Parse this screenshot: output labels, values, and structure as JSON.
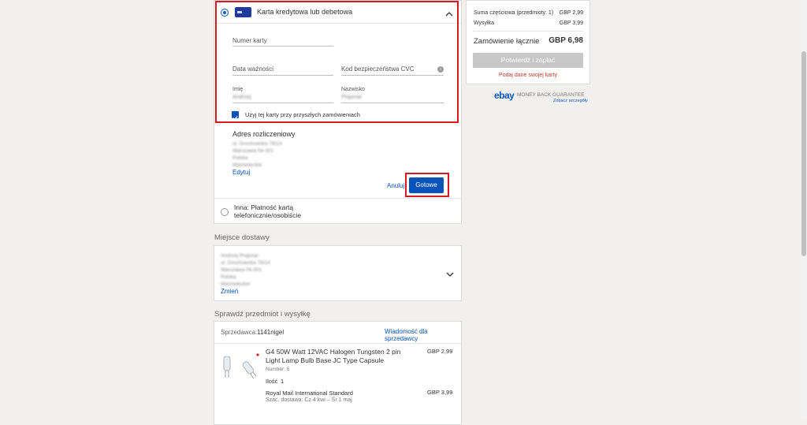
{
  "payment": {
    "card_title": "Karta kredytowa lub debetowa",
    "card_number_label": "Numer karty",
    "expiry_label": "Data ważności",
    "cvc_label": "Kod bezpieczeństwa CVC",
    "first_name_label": "Imię",
    "first_name_value": "Andrzej",
    "last_name_label": "Nazwisko",
    "last_name_value": "Prajsnar",
    "save_card_label": "Użyj tej karty przy przyszłych zamówieniach",
    "save_card_checked": true,
    "billing_title": "Adres rozliczeniowy",
    "billing_lines": [
      "ul. Grochowska 78/14",
      "Warszawa 04-301",
      "Polska",
      "Mazowieckie"
    ],
    "edit_label": "Edytuj",
    "cancel_label": "Anuluj",
    "done_label": "Gotowe",
    "other_option_label": "Inna: Płatność kartą telefonicznie/osobiście"
  },
  "delivery": {
    "section_title": "Miejsce dostawy",
    "lines": [
      "Andrzej Prajsnar",
      "ul. Grochowska 78/14",
      "Warszawa 04-301",
      "Polska",
      "Mazowieckie"
    ],
    "change_label": "Zmień"
  },
  "review": {
    "section_title": "Sprawdź przedmiot i wysyłkę",
    "seller_prefix": "Sprzedawca:",
    "seller_name": "1141nigel",
    "message_seller_label": "Wiadomość dla sprzedawcy",
    "item_title": "G4 50W Watt 12VAC Halogen Tungsten 2 pin Light Lamp Bulb Base JC Type Capsule",
    "item_number": "Number: 5",
    "item_price": "GBP 2,99",
    "quantity_label": "Ilość",
    "quantity_value": "1",
    "shipping_method": "Royal Mail International Standard",
    "shipping_price": "GBP 3,99",
    "shipping_eta": "Szac. dostawa: Cz 4 kwi – Śr 1 maj"
  },
  "summary": {
    "subtotal_label": "Suma częściowa (przedmioty: 1)",
    "subtotal_value": "GBP 2,99",
    "shipping_label": "Wysyłka",
    "shipping_value": "GBP 3,99",
    "total_label": "Zamówienie łącznie",
    "total_value": "GBP 6,98",
    "confirm_label": "Potwierdź i zapłać",
    "card_notice": "Podaj dane swojej karty"
  },
  "guarantee": {
    "brand": "ebay",
    "text": "MONEY BACK GUARANTEE",
    "link": "Zobacz szczegóły"
  },
  "colors": {
    "accent": "#0654ba",
    "highlight_box": "#d51c24",
    "background": "#f1f0ef"
  }
}
